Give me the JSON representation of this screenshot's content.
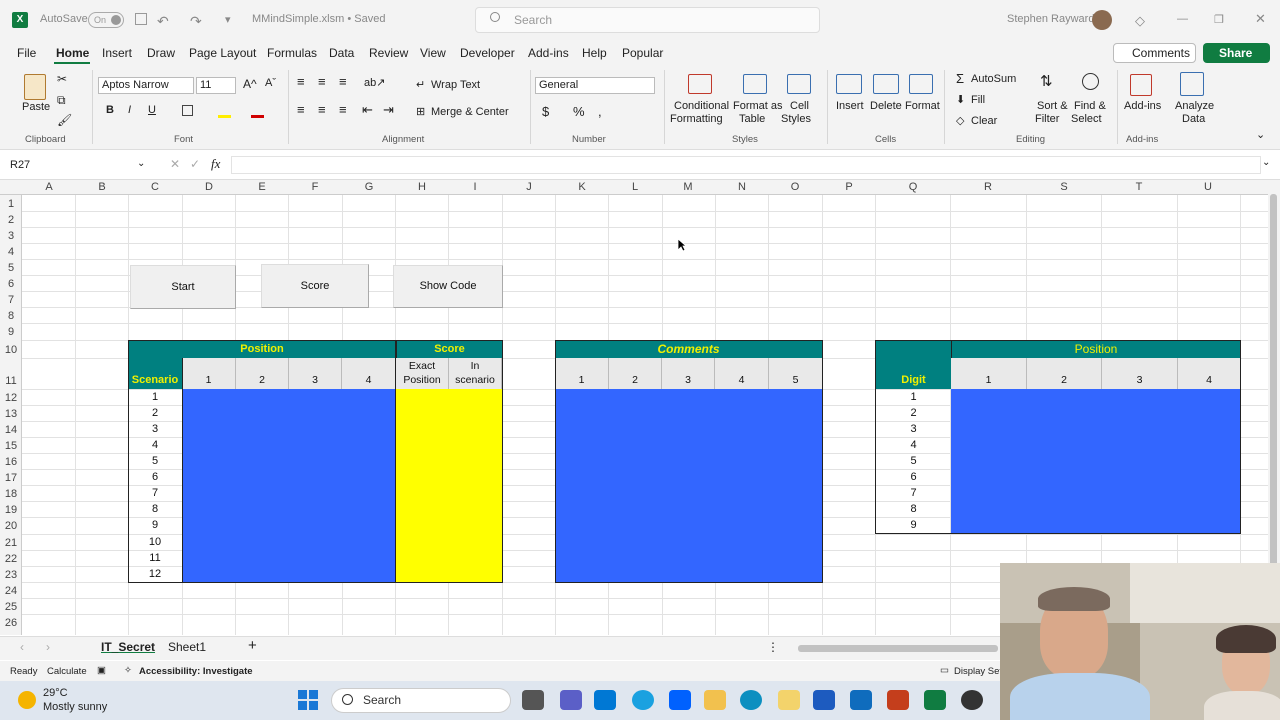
{
  "titlebar": {
    "autosave": "AutoSave",
    "toggle": "On",
    "filename": "MMindSimple.xlsm • Saved",
    "search_placeholder": "Search",
    "user": "Stephen Rayward"
  },
  "menu": [
    "File",
    "Home",
    "Insert",
    "Draw",
    "Page Layout",
    "Formulas",
    "Data",
    "Review",
    "View",
    "Developer",
    "Add-ins",
    "Help",
    "Popular"
  ],
  "comments_btn": "Comments",
  "share_btn": "Share",
  "ribbon": {
    "paste": "Paste",
    "font_name": "Aptos Narrow",
    "font_size": "11",
    "wrap_text": "Wrap Text",
    "merge_center": "Merge & Center",
    "number_format": "General",
    "conditional": "Conditional",
    "formatting": "Formatting",
    "format_as": "Format as",
    "table": "Table",
    "cell": "Cell",
    "styles": "Styles",
    "insert": "Insert",
    "delete": "Delete",
    "format": "Format",
    "autosum": "AutoSum",
    "fill": "Fill",
    "clear": "Clear",
    "sort": "Sort &",
    "filter": "Filter",
    "find": "Find &",
    "select": "Select",
    "addins": "Add-ins",
    "analyze": "Analyze",
    "data": "Data",
    "groups": {
      "clipboard": "Clipboard",
      "font": "Font",
      "alignment": "Alignment",
      "number": "Number",
      "styles": "Styles",
      "cells": "Cells",
      "editing": "Editing",
      "addins": "Add-ins"
    }
  },
  "formula_bar": {
    "namebox": "R27",
    "fx": "fx",
    "value": ""
  },
  "columns": [
    "A",
    "B",
    "C",
    "D",
    "E",
    "F",
    "G",
    "H",
    "I",
    "J",
    "K",
    "L",
    "M",
    "N",
    "O",
    "P",
    "Q",
    "R",
    "S",
    "T",
    "U"
  ],
  "rows": [
    "1",
    "2",
    "3",
    "4",
    "5",
    "6",
    "7",
    "8",
    "9",
    "10",
    "11",
    "12",
    "13",
    "14",
    "15",
    "16",
    "17",
    "18",
    "19",
    "20",
    "21",
    "22",
    "23",
    "24",
    "25",
    "26"
  ],
  "buttons": {
    "start": "Start",
    "score": "Score",
    "show_code": "Show Code"
  },
  "table1": {
    "position": "Position",
    "score": "Score",
    "scenario": "Scenario",
    "cols": [
      "1",
      "2",
      "3",
      "4"
    ],
    "exact": "Exact",
    "exact2": "Position",
    "in": "In",
    "in2": "scenario",
    "scenarios": [
      "1",
      "2",
      "3",
      "4",
      "5",
      "6",
      "7",
      "8",
      "9",
      "10",
      "11",
      "12"
    ]
  },
  "table2": {
    "comments": "Comments",
    "cols": [
      "1",
      "2",
      "3",
      "4",
      "5"
    ]
  },
  "table3": {
    "position": "Position",
    "digit": "Digit",
    "cols": [
      "1",
      "2",
      "3",
      "4"
    ],
    "digits": [
      "1",
      "2",
      "3",
      "4",
      "5",
      "6",
      "7",
      "8",
      "9"
    ]
  },
  "sheets": [
    "IT_Secret",
    "Sheet1"
  ],
  "status": {
    "ready": "Ready",
    "calculate": "Calculate",
    "accessibility": "Accessibility: Investigate",
    "display": "Display Sett"
  },
  "taskbar": {
    "temp": "29°C",
    "weather": "Mostly sunny",
    "search": "Search"
  },
  "colors": {
    "teal": "#008080",
    "blue": "#3366ff",
    "yellow": "#ffff00",
    "excel_green": "#107c41"
  }
}
